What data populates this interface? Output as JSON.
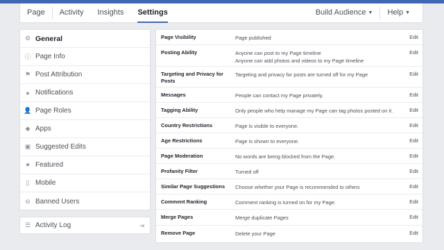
{
  "nav": {
    "tabs": [
      {
        "label": "Page"
      },
      {
        "label": "Activity"
      },
      {
        "label": "Insights"
      },
      {
        "label": "Settings"
      }
    ],
    "build_audience": "Build Audience",
    "help": "Help"
  },
  "sidebar": {
    "items": [
      {
        "label": "General",
        "icon": "gear-icon"
      },
      {
        "label": "Page Info",
        "icon": "info-icon"
      },
      {
        "label": "Post Attribution",
        "icon": "flag-icon"
      },
      {
        "label": "Notifications",
        "icon": "globe-icon"
      },
      {
        "label": "Page Roles",
        "icon": "person-icon"
      },
      {
        "label": "Apps",
        "icon": "cube-icon"
      },
      {
        "label": "Suggested Edits",
        "icon": "edit-box-icon"
      },
      {
        "label": "Featured",
        "icon": "star-icon"
      },
      {
        "label": "Mobile",
        "icon": "mobile-icon"
      },
      {
        "label": "Banned Users",
        "icon": "ban-icon"
      }
    ]
  },
  "activity_log": {
    "label": "Activity Log",
    "icon": "list-icon"
  },
  "settings": {
    "edit_label": "Edit",
    "rows": [
      {
        "name": "Page Visibility",
        "value": [
          "Page published"
        ]
      },
      {
        "name": "Posting Ability",
        "value": [
          "Anyone can post to my Page timeline",
          "Anyone can add photos and videos to my Page timeline"
        ]
      },
      {
        "name": "Targeting and Privacy for Posts",
        "value": [
          "Targeting and privacy for posts are turned off for my Page"
        ]
      },
      {
        "name": "Messages",
        "value": [
          "People can contact my Page privately."
        ]
      },
      {
        "name": "Tagging Ability",
        "value": [
          "Only people who help manage my Page can tag photos posted on it."
        ]
      },
      {
        "name": "Country Restrictions",
        "value": [
          "Page is visible to everyone."
        ]
      },
      {
        "name": "Age Restrictions",
        "value": [
          "Page is shown to everyone."
        ]
      },
      {
        "name": "Page Moderation",
        "value": [
          "No words are being blocked from the Page."
        ]
      },
      {
        "name": "Profanity Filter",
        "value": [
          "Turned off"
        ]
      },
      {
        "name": "Similar Page Suggestions",
        "value": [
          "Choose whether your Page is recommended to others"
        ]
      },
      {
        "name": "Comment Ranking",
        "value": [
          "Comment ranking is turned on for my Page."
        ]
      },
      {
        "name": "Merge Pages",
        "value": [
          "Merge duplicate Pages"
        ]
      },
      {
        "name": "Remove Page",
        "value": [
          "Delete your Page"
        ]
      }
    ]
  },
  "colors": {
    "accent": "#4267b2",
    "background": "#e9ebee"
  }
}
